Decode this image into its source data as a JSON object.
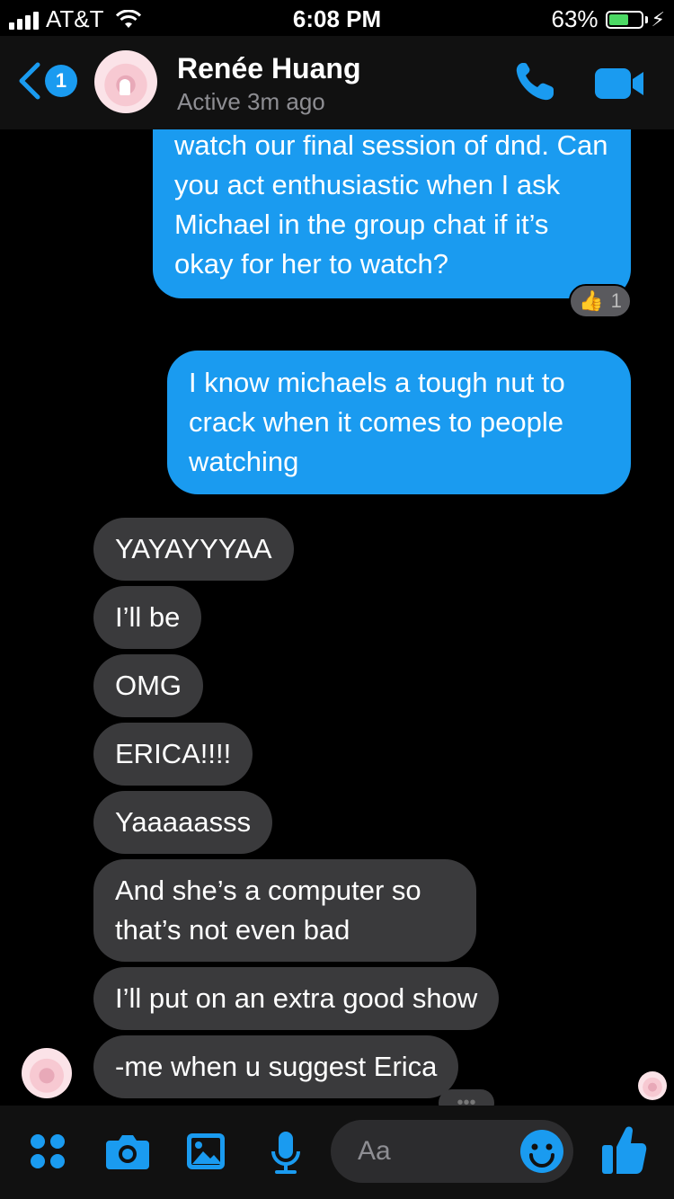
{
  "status_bar": {
    "carrier": "AT&T",
    "time": "6:08 PM",
    "battery": "63%",
    "battery_level": 0.63
  },
  "header": {
    "back_badge": "1",
    "contact_name": "Renée Huang",
    "active_status": "Active 3m ago",
    "icons": [
      "chevron-left-icon",
      "phone-icon",
      "video-camera-icon"
    ]
  },
  "messages": [
    {
      "from": "me",
      "text": "watch our final session of dnd. Can you act enthusiastic when I ask Michael in the group chat if it’s okay for her to watch?"
    },
    {
      "from": "me",
      "text": "I know michaels a tough nut to crack when it comes to people watching"
    },
    {
      "from": "them",
      "text": "YAYAYYYAA"
    },
    {
      "from": "them",
      "text": "I’ll be"
    },
    {
      "from": "them",
      "text": "OMG"
    },
    {
      "from": "them",
      "text": "ERICA!!!!"
    },
    {
      "from": "them",
      "text": "Yaaaaasss"
    },
    {
      "from": "them",
      "text": "And she’s a computer so that’s not even bad"
    },
    {
      "from": "them",
      "text": "I’ll put on an extra good show"
    },
    {
      "from": "them",
      "text": "-me when u suggest Erica"
    }
  ],
  "reaction": {
    "emoji": "👍",
    "count": "1"
  },
  "composer": {
    "placeholder": "Aa",
    "icons": [
      "apps-icon",
      "camera-icon",
      "image-icon",
      "microphone-icon",
      "smiley-icon",
      "thumbs-up-icon"
    ]
  },
  "colors": {
    "accent": "#1a9bf0",
    "incoming_bubble": "#3a3a3c",
    "background": "#000000"
  }
}
